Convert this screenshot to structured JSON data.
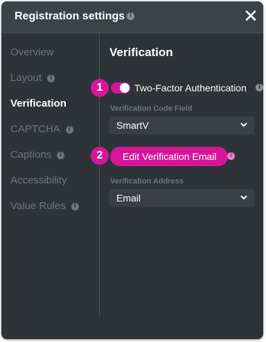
{
  "header": {
    "title": "Registration settings",
    "info_icon": "info-icon",
    "close_icon": "close-icon"
  },
  "sidebar": {
    "items": [
      {
        "label": "Overview"
      },
      {
        "label": "Layout"
      },
      {
        "label": "Verification"
      },
      {
        "label": "CAPTCHA"
      },
      {
        "label": "Captions"
      },
      {
        "label": "Accessibility"
      },
      {
        "label": "Value Rules"
      }
    ]
  },
  "main": {
    "section_title": "Verification",
    "steps": [
      "1",
      "2"
    ],
    "two_factor": {
      "label": "Two-Factor Authentication",
      "enabled": true
    },
    "code_field": {
      "label": "Verification Code Field",
      "value": "SmartV"
    },
    "edit_email_button": {
      "label": "Edit Verification Email"
    },
    "address": {
      "label": "Verification Address",
      "value": "Email"
    }
  },
  "colors": {
    "panel": "#2e3338",
    "accent": "#d6169a",
    "text": "#ffffff",
    "muted": "#6e757c"
  }
}
